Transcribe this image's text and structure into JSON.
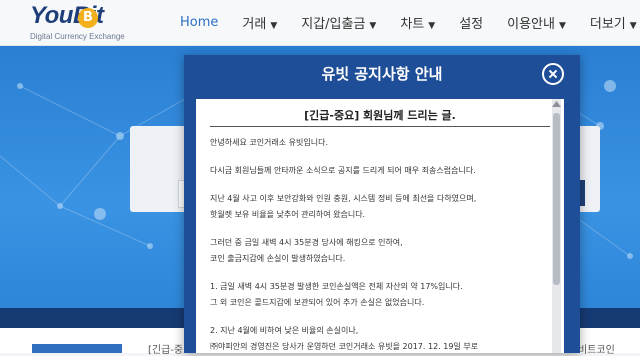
{
  "logo": {
    "brand": "YouBit",
    "coin_glyph": "B",
    "tagline": "Digital Currency Exchange"
  },
  "nav": {
    "items": [
      {
        "label": "Home",
        "active": true,
        "dropdown": false
      },
      {
        "label": "거래",
        "dropdown": true
      },
      {
        "label": "지갑/입출금",
        "dropdown": true
      },
      {
        "label": "차트",
        "dropdown": true
      },
      {
        "label": "설정",
        "dropdown": false
      },
      {
        "label": "이용안내",
        "dropdown": true
      },
      {
        "label": "더보기",
        "dropdown": true
      }
    ],
    "caret": "▼"
  },
  "modal": {
    "title": "유빗 공지사항 안내",
    "notice_title": "[긴급-중요] 회원님께 드리는 글.",
    "body": [
      "안녕하세요 코인거래소 유빗입니다.",
      "",
      "다시금 회원님들께 안타까운 소식으로 공지를 드리게 되어 매우 죄송스럽습니다.",
      "",
      "지난 4월 사고 이후 보안강화와 인원 충원, 시스템 정비 등에 최선을 다하였으며,",
      "핫월렛 보유 비율을 낮추어 관리하여 왔습니다.",
      "",
      "그러던 중 금일 새벽 4시 35분경 당사에 해킹으로 인하여,",
      "코인 출금지갑에 손실이 발생하였습니다.",
      "",
      "1. 금일 새벽 4시 35분경 발생한 코인손실액은 전체 자산의 약 17%입니다.",
      "그 외 코인은 콜드지갑에 보관되어 있어 추가 손실은 없었습니다.",
      "",
      "2. 지난 4월에 비하여 낮은 비율의 손실이나,",
      "㈜야피안의 경영진은 당사가 운영하던 코인거래소 유빗을 2017. 12. 19일 부로"
    ]
  },
  "bottom": {
    "ticker_left": "[긴급-중요",
    "ticker_right": "비트코인"
  },
  "colors": {
    "nav_active": "#2d6fc5",
    "modal_bg": "#1f4e99",
    "hero": "#2e86d9",
    "band": "#163a73"
  },
  "icons": [
    "close-icon",
    "bitcoin-coin-icon",
    "chevron-down-icon"
  ]
}
